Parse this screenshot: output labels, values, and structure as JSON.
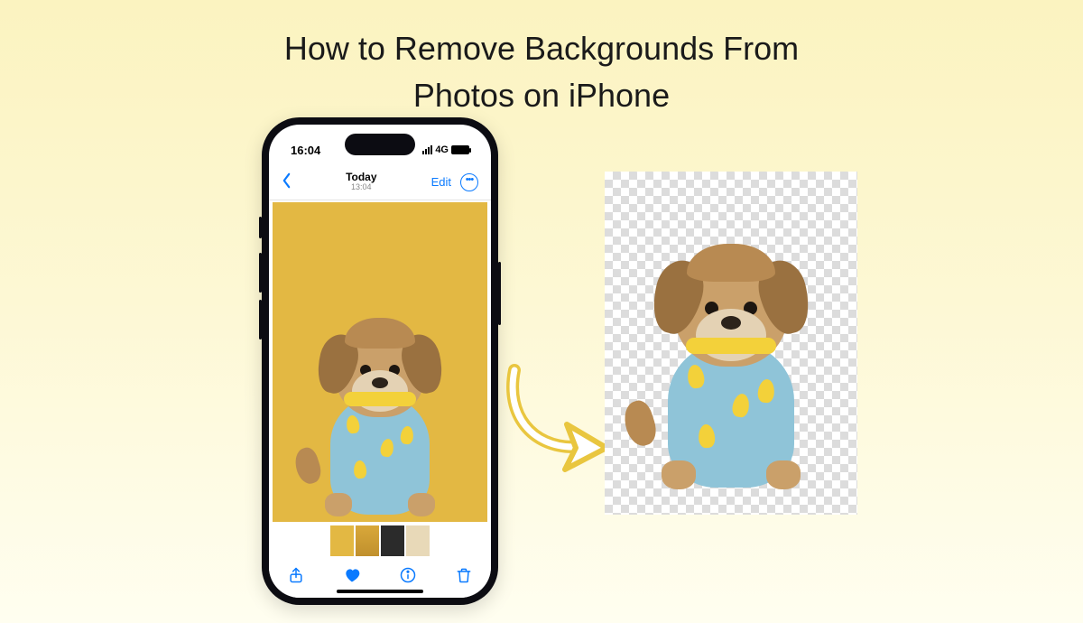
{
  "title_line1": "How to Remove Backgrounds From",
  "title_line2": "Photos on iPhone",
  "statusbar": {
    "time": "16:04",
    "network": "4G"
  },
  "navbar": {
    "title": "Today",
    "subtitle": "13:04",
    "edit": "Edit"
  },
  "photo": {
    "subject": "small tan dog wearing blue banana-print shirt",
    "background_color": "#e3b843"
  },
  "toolbar": {
    "share": "share-icon",
    "favorite": "heart-icon",
    "info": "info-icon",
    "delete": "trash-icon"
  },
  "result": {
    "description": "same dog cut out onto transparent checkerboard"
  }
}
